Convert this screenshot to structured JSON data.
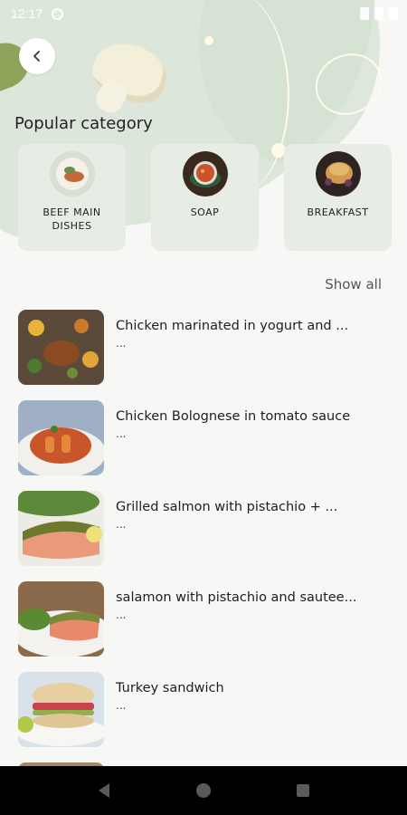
{
  "status_bar": {
    "time": "12:17",
    "notification_icon": "circle-icon"
  },
  "header": {
    "back_icon": "chevron-left-icon"
  },
  "section_title": "Popular category",
  "categories": [
    {
      "label": "BEEF MAIN DISHES",
      "icon": "beef-dish-image"
    },
    {
      "label": "SOAP",
      "icon": "soup-bowl-image"
    },
    {
      "label": "BREAKFAST",
      "icon": "breakfast-bun-image"
    }
  ],
  "show_all_label": "Show all",
  "recipes": [
    {
      "title": "Chicken marinated in yogurt and ...",
      "subtitle": "..."
    },
    {
      "title": "Chicken Bolognese in tomato sauce",
      "subtitle": "..."
    },
    {
      "title": "Grilled salmon with pistachio + ...",
      "subtitle": "..."
    },
    {
      "title": "salamon with pistachio and sautee...",
      "subtitle": "..."
    },
    {
      "title": "Turkey sandwich",
      "subtitle": "..."
    }
  ],
  "nav": {
    "back": "triangle-back-icon",
    "home": "circle-home-icon",
    "recents": "square-recents-icon"
  },
  "colors": {
    "background": "#f7f7f5",
    "header_green": "#dde6da",
    "card": "#e7ece4",
    "nav": "#000000"
  }
}
